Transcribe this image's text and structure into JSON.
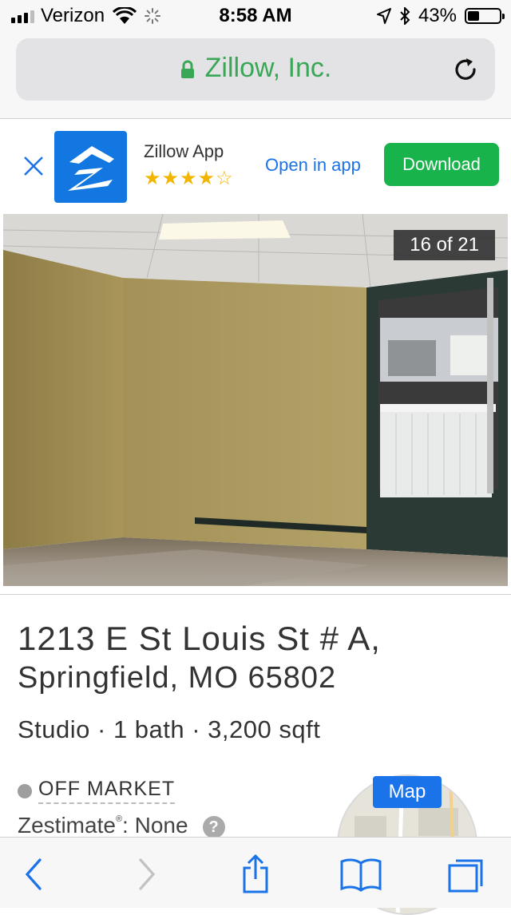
{
  "status_bar": {
    "carrier": "Verizon",
    "time": "8:58 AM",
    "battery": "43%",
    "battery_level": 0.43
  },
  "url_bar": {
    "site": "Zillow, Inc."
  },
  "app_banner": {
    "app_name": "Zillow App",
    "rating": 4,
    "rating_max": 5,
    "open_label": "Open in app",
    "download_label": "Download"
  },
  "photo": {
    "counter": "16 of 21"
  },
  "listing": {
    "address_line1": "1213 E St Louis St # A,",
    "address_line2": "Springfield, MO 65802",
    "facts": "Studio · 1 bath · 3,200 sqft",
    "status": "OFF MARKET",
    "zestimate_label": "Zestimate",
    "zestimate_mark": "®",
    "zestimate_value": ": None",
    "help": "?",
    "map_label": "Map"
  },
  "colors": {
    "accent_blue": "#1a73e8",
    "download_green": "#19b34c",
    "secure_green": "#3aa757",
    "zillow_blue": "#1277e1"
  },
  "icons": [
    "signal-icon",
    "wifi-icon",
    "activity-spinner-icon",
    "location-icon",
    "bluetooth-icon",
    "battery-icon",
    "lock-icon",
    "reload-icon",
    "close-icon",
    "zillow-logo-icon",
    "help-icon",
    "back-icon",
    "forward-icon",
    "share-icon",
    "bookmarks-icon",
    "tabs-icon"
  ]
}
